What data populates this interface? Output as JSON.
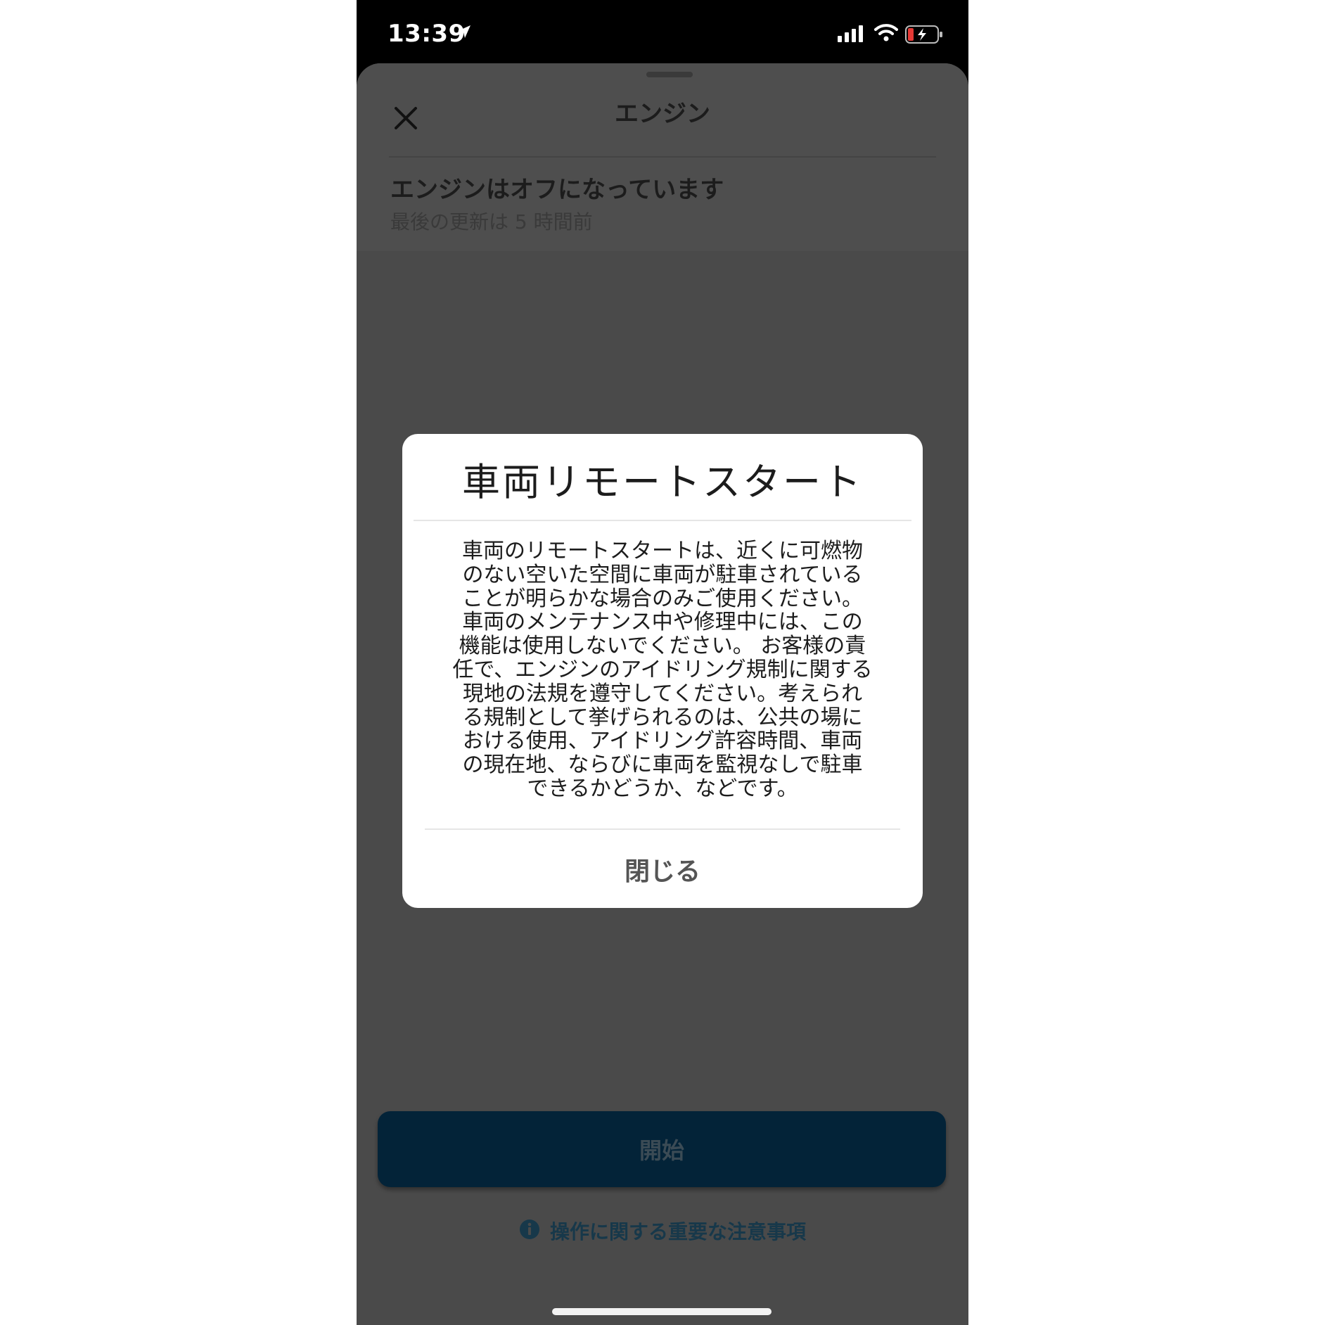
{
  "status_bar": {
    "time": "13:39",
    "icons": [
      "location-arrow-icon",
      "signal-icon",
      "wifi-icon",
      "battery-charging-icon"
    ],
    "battery_color": "#e53935"
  },
  "sheet": {
    "title": "エンジン",
    "close_icon": "close-icon",
    "engine_status": "エンジンはオフになっています",
    "last_updated": "最後の更新は 5 時間前",
    "start_button_label": "開始",
    "notice_icon": "info-icon",
    "notice_label": "操作に関する重要な注意事項",
    "accent_color": "#032338"
  },
  "modal": {
    "title": "車両リモートスタート",
    "body": "車両のリモートスタートは、近くに可燃物\nのない空いた空間に車両が駐車されている\nことが明らかな場合のみご使用ください。\n車両のメンテナンス中や修理中には、この\n機能は使用しないでください。 お客様の責\n任で、エンジンのアイドリング規制に関する\n現地の法規を遵守してください。考えられ\nる規制として挙げられるのは、公共の場に\nおける使用、アイドリング許容時間、車両\nの現在地、ならびに車両を監視なしで駐車\nできるかどうか、などです。",
    "close_label": "閉じる"
  }
}
